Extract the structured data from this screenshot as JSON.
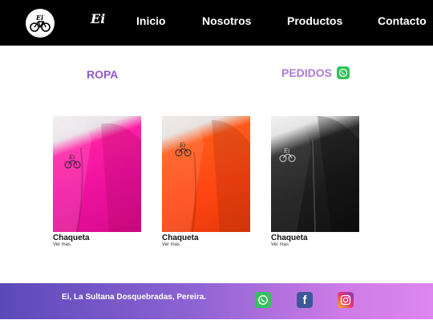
{
  "header": {
    "brand": "Ei",
    "nav": [
      "Inicio",
      "Nosotros",
      "Productos",
      "Contacto"
    ]
  },
  "sections": {
    "ropa": "ROPA",
    "pedidos": "PEDIDOS"
  },
  "products": [
    {
      "name": "Chaqueta",
      "more": "Ver mas",
      "color": "#ff1fa4"
    },
    {
      "name": "Chaqueta",
      "more": "Ver mas",
      "color": "#ff4612"
    },
    {
      "name": "Chaqueta",
      "more": "Ver mas",
      "color": "#1c1c1c"
    }
  ],
  "footer": {
    "address": "Ei, La Sultana Dosquebradas, Pereira.",
    "social": [
      "whatsapp-icon",
      "facebook-icon",
      "instagram-icon"
    ]
  },
  "colors": {
    "header_bg": "#000000",
    "title_purple": "#8e5bc8",
    "footer_start": "#5b49b8",
    "footer_end": "#dd86ee"
  }
}
